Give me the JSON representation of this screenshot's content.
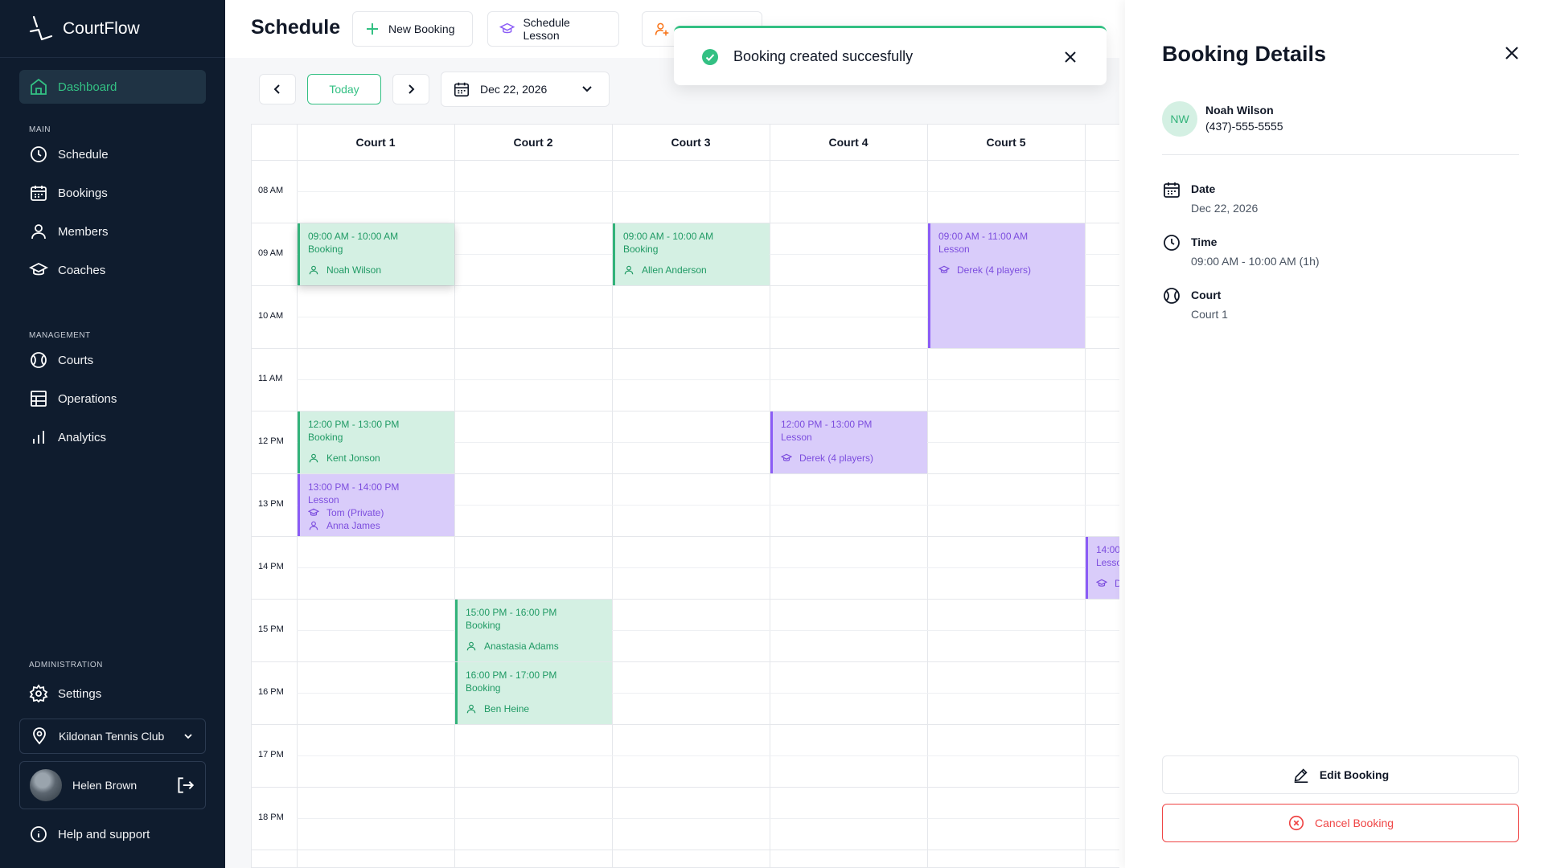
{
  "app": {
    "name": "CourtFlow"
  },
  "sidebar": {
    "dashboard": "Dashboard",
    "sections": {
      "main": "MAIN",
      "management": "MANAGEMENT",
      "administration": "ADMINISTRATION"
    },
    "main_items": [
      "Schedule",
      "Bookings",
      "Members",
      "Coaches"
    ],
    "management_items": [
      "Courts",
      "Operations",
      "Analytics"
    ],
    "settings": "Settings",
    "club": "Kildonan Tennis Club",
    "user": "Helen Brown",
    "help": "Help and support"
  },
  "header": {
    "title": "Schedule",
    "new_booking": "New Booking",
    "schedule_lesson": "Schedule Lesson"
  },
  "toolbar": {
    "today": "Today",
    "date": "Dec 22, 2026"
  },
  "courts": [
    "Court 1",
    "Court 2",
    "Court 3",
    "Court 4",
    "Court 5"
  ],
  "times": [
    "08 AM",
    "09 AM",
    "10 AM",
    "11 AM",
    "12 PM",
    "13 PM",
    "14 PM",
    "15 PM",
    "16 PM",
    "17 PM",
    "18 PM"
  ],
  "events": [
    {
      "court": 1,
      "time": "09:00 AM - 10:00 AM",
      "type": "Booking",
      "people": [
        "Noah Wilson"
      ]
    },
    {
      "court": 3,
      "time": "09:00 AM - 10:00 AM",
      "type": "Booking",
      "people": [
        "Allen Anderson"
      ]
    },
    {
      "court": 5,
      "time": "09:00 AM - 11:00 AM",
      "type": "Lesson",
      "people": [
        "Derek (4 players)"
      ]
    },
    {
      "court": 1,
      "time": "12:00 PM - 13:00 PM",
      "type": "Booking",
      "people": [
        "Kent Jonson"
      ]
    },
    {
      "court": 4,
      "time": "12:00 PM - 13:00 PM",
      "type": "Lesson",
      "people": [
        "Derek (4 players)"
      ]
    },
    {
      "court": 1,
      "time": "13:00 PM - 14:00 PM",
      "type": "Lesson",
      "people": [
        "Tom (Private)",
        "Anna James"
      ]
    },
    {
      "court": 6,
      "time": "14:00",
      "type": "Lesso",
      "people": [
        "De"
      ]
    },
    {
      "court": 2,
      "time": "15:00 PM - 16:00 PM",
      "type": "Booking",
      "people": [
        "Anastasia Adams"
      ]
    },
    {
      "court": 2,
      "time": "16:00 PM - 17:00 PM",
      "type": "Booking",
      "people": [
        "Ben Heine"
      ]
    }
  ],
  "toast": {
    "message": "Booking created succesfully"
  },
  "details": {
    "title": "Booking Details",
    "initials": "NW",
    "member_name": "Noah Wilson",
    "member_phone": "(437)-555-5555",
    "date_label": "Date",
    "date_value": "Dec 22, 2026",
    "time_label": "Time",
    "time_value": "09:00 AM - 10:00 AM (1h)",
    "court_label": "Court",
    "court_value": "Court 1",
    "edit": "Edit Booking",
    "cancel": "Cancel Booking"
  },
  "colors": {
    "accent": "#33c083",
    "sidebar": "#0f1c2e",
    "booking": "#d4f0e3",
    "lesson": "#d9ccfa",
    "danger": "#ef4444"
  }
}
